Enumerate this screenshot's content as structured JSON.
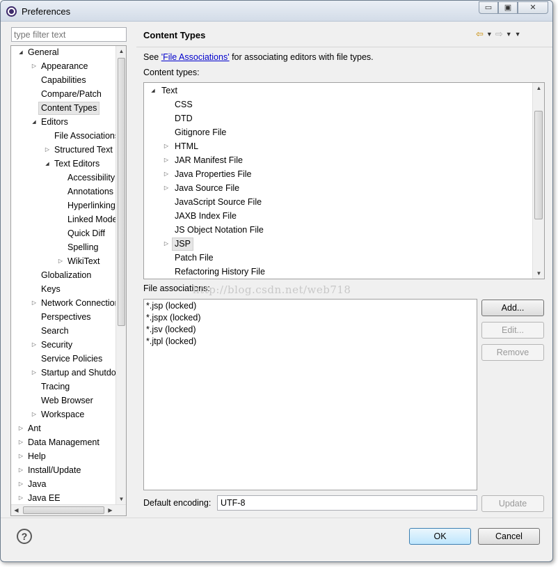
{
  "window": {
    "title": "Preferences",
    "minimize_symbol": "▭",
    "maximize_symbol": "▣",
    "close_symbol": "✕"
  },
  "filter": {
    "placeholder": "type filter text"
  },
  "left_tree": {
    "items": [
      {
        "label": "General",
        "depth": 0,
        "toggle": "expanded"
      },
      {
        "label": "Appearance",
        "depth": 1,
        "toggle": "collapsed"
      },
      {
        "label": "Capabilities",
        "depth": 1,
        "toggle": "none"
      },
      {
        "label": "Compare/Patch",
        "depth": 1,
        "toggle": "none"
      },
      {
        "label": "Content Types",
        "depth": 1,
        "toggle": "none",
        "selected": true
      },
      {
        "label": "Editors",
        "depth": 1,
        "toggle": "expanded"
      },
      {
        "label": "File Associations",
        "depth": 2,
        "toggle": "none"
      },
      {
        "label": "Structured Text Editors",
        "depth": 2,
        "toggle": "collapsed"
      },
      {
        "label": "Text Editors",
        "depth": 2,
        "toggle": "expanded"
      },
      {
        "label": "Accessibility",
        "depth": 3,
        "toggle": "none"
      },
      {
        "label": "Annotations",
        "depth": 3,
        "toggle": "none"
      },
      {
        "label": "Hyperlinking",
        "depth": 3,
        "toggle": "none"
      },
      {
        "label": "Linked Mode",
        "depth": 3,
        "toggle": "none"
      },
      {
        "label": "Quick Diff",
        "depth": 3,
        "toggle": "none"
      },
      {
        "label": "Spelling",
        "depth": 3,
        "toggle": "none"
      },
      {
        "label": "WikiText",
        "depth": 3,
        "toggle": "collapsed"
      },
      {
        "label": "Globalization",
        "depth": 1,
        "toggle": "none"
      },
      {
        "label": "Keys",
        "depth": 1,
        "toggle": "none"
      },
      {
        "label": "Network Connections",
        "depth": 1,
        "toggle": "collapsed"
      },
      {
        "label": "Perspectives",
        "depth": 1,
        "toggle": "none"
      },
      {
        "label": "Search",
        "depth": 1,
        "toggle": "none"
      },
      {
        "label": "Security",
        "depth": 1,
        "toggle": "collapsed"
      },
      {
        "label": "Service Policies",
        "depth": 1,
        "toggle": "none"
      },
      {
        "label": "Startup and Shutdown",
        "depth": 1,
        "toggle": "collapsed"
      },
      {
        "label": "Tracing",
        "depth": 1,
        "toggle": "none"
      },
      {
        "label": "Web Browser",
        "depth": 1,
        "toggle": "none"
      },
      {
        "label": "Workspace",
        "depth": 1,
        "toggle": "collapsed"
      },
      {
        "label": "Ant",
        "depth": 0,
        "toggle": "collapsed"
      },
      {
        "label": "Data Management",
        "depth": 0,
        "toggle": "collapsed"
      },
      {
        "label": "Help",
        "depth": 0,
        "toggle": "collapsed"
      },
      {
        "label": "Install/Update",
        "depth": 0,
        "toggle": "collapsed"
      },
      {
        "label": "Java",
        "depth": 0,
        "toggle": "collapsed"
      },
      {
        "label": "Java EE",
        "depth": 0,
        "toggle": "collapsed"
      }
    ]
  },
  "page": {
    "title": "Content Types",
    "desc_prefix": "See ",
    "desc_link": "'File Associations'",
    "desc_suffix": " for associating editors with file types.",
    "content_types_label": "Content types:",
    "file_assoc_label": "File associations:",
    "watermark": "http://blog.csdn.net/web718",
    "encoding_label": "Default encoding:",
    "encoding_value": "UTF-8"
  },
  "content_types": [
    {
      "label": "Text",
      "depth": 0,
      "toggle": "expanded"
    },
    {
      "label": "CSS",
      "depth": 1,
      "toggle": "none"
    },
    {
      "label": "DTD",
      "depth": 1,
      "toggle": "none"
    },
    {
      "label": "Gitignore File",
      "depth": 1,
      "toggle": "none"
    },
    {
      "label": "HTML",
      "depth": 1,
      "toggle": "collapsed"
    },
    {
      "label": "JAR Manifest File",
      "depth": 1,
      "toggle": "collapsed"
    },
    {
      "label": "Java Properties File",
      "depth": 1,
      "toggle": "collapsed"
    },
    {
      "label": "Java Source File",
      "depth": 1,
      "toggle": "collapsed"
    },
    {
      "label": "JavaScript Source File",
      "depth": 1,
      "toggle": "none"
    },
    {
      "label": "JAXB Index File",
      "depth": 1,
      "toggle": "none"
    },
    {
      "label": "JS Object Notation File",
      "depth": 1,
      "toggle": "none"
    },
    {
      "label": "JSP",
      "depth": 1,
      "toggle": "collapsed",
      "selected": true
    },
    {
      "label": "Patch File",
      "depth": 1,
      "toggle": "none"
    },
    {
      "label": "Refactoring History File",
      "depth": 1,
      "toggle": "none"
    }
  ],
  "file_associations": [
    "*.jsp (locked)",
    "*.jspx (locked)",
    "*.jsv (locked)",
    "*.jtpl (locked)"
  ],
  "buttons": {
    "add": "Add...",
    "edit": "Edit...",
    "remove": "Remove",
    "update": "Update",
    "ok": "OK",
    "cancel": "Cancel"
  },
  "icons": {
    "help": "?",
    "back": "⇦",
    "forward": "⇨",
    "dropdown": "▼"
  },
  "colors": {
    "link": "#0000cc",
    "nav_arrow": "#c98a00",
    "primary_button": "#bee6fd"
  }
}
